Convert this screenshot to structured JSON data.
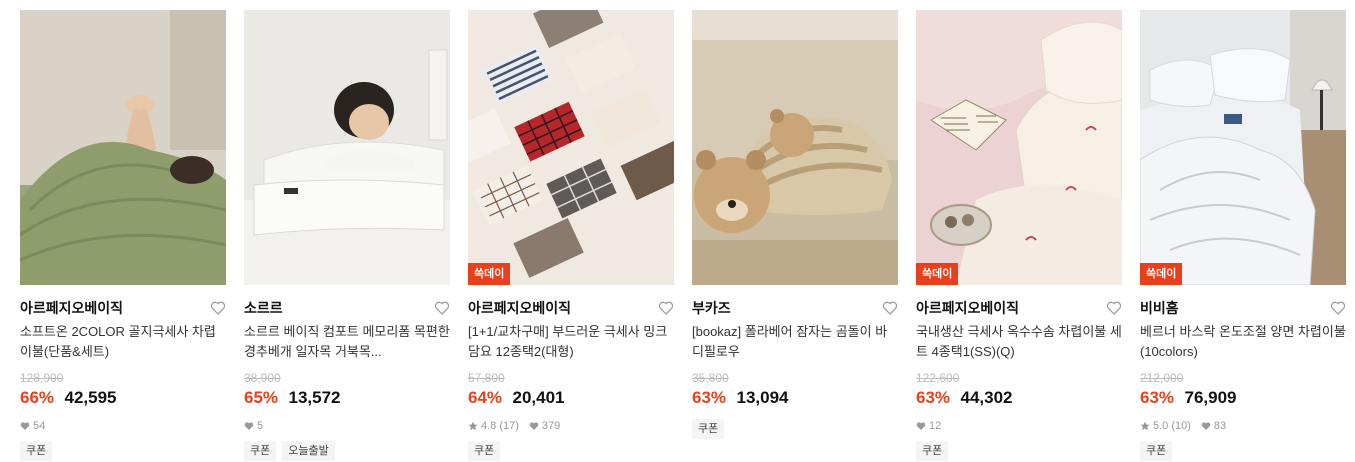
{
  "products": [
    {
      "brand": "아르페지오베이직",
      "title": "소프트온 2COLOR 골지극세사 차렵이불(단품&세트)",
      "original_price": "128,900",
      "discount": "66%",
      "price": "42,595",
      "rating": "",
      "reviews": "",
      "likes": "54",
      "badge": "",
      "tags": [
        "쿠폰"
      ],
      "image": "green-blanket-photo"
    },
    {
      "brand": "소르르",
      "title": "소르르 베이직 컴포트 메모리폼 목편한 경추베개 일자목 거북목...",
      "original_price": "38,900",
      "discount": "65%",
      "price": "13,572",
      "rating": "",
      "reviews": "",
      "likes": "5",
      "badge": "",
      "tags": [
        "쿠폰",
        "오늘출발"
      ],
      "image": "memory-foam-pillow-photo"
    },
    {
      "brand": "아르페지오베이직",
      "title": "[1+1/교차구매] 부드러운 극세사 밍크담요 12종택2(대형)",
      "original_price": "57,800",
      "discount": "64%",
      "price": "20,401",
      "rating": "4.8",
      "reviews": "(17)",
      "likes": "379",
      "badge": "쓱데이",
      "tags": [
        "쿠폰"
      ],
      "image": "folded-blankets-photo"
    },
    {
      "brand": "부카즈",
      "title": "[bookaz] 폴라베어 잠자는 곰돌이 바디필로우",
      "original_price": "35,800",
      "discount": "63%",
      "price": "13,094",
      "rating": "",
      "reviews": "",
      "likes": "",
      "badge": "",
      "tags": [
        "쿠폰"
      ],
      "image": "bear-body-pillow-photo"
    },
    {
      "brand": "아르페지오베이직",
      "title": "국내생산 극세사 옥수수솜 차렵이불 세트 4종택1(SS)(Q)",
      "original_price": "122,600",
      "discount": "63%",
      "price": "44,302",
      "rating": "",
      "reviews": "",
      "likes": "12",
      "badge": "쓱데이",
      "tags": [
        "쿠폰"
      ],
      "image": "pink-bedding-photo"
    },
    {
      "brand": "비비홈",
      "title": "베르너 바스락 온도조절 양면 차렵이불 (10colors)",
      "original_price": "212,000",
      "discount": "63%",
      "price": "76,909",
      "rating": "5.0",
      "reviews": "(10)",
      "likes": "83",
      "badge": "쓱데이",
      "tags": [
        "쿠폰"
      ],
      "image": "white-bedding-photo"
    }
  ],
  "colors": {
    "discount": "#e8401c",
    "badge_bg": "#e8401c",
    "strike": "#bbbbbb",
    "tag_bg": "#f4f4f4"
  },
  "icons": {
    "like": "heart-outline-icon",
    "star": "star-icon",
    "likes_count": "heart-filled-icon"
  }
}
